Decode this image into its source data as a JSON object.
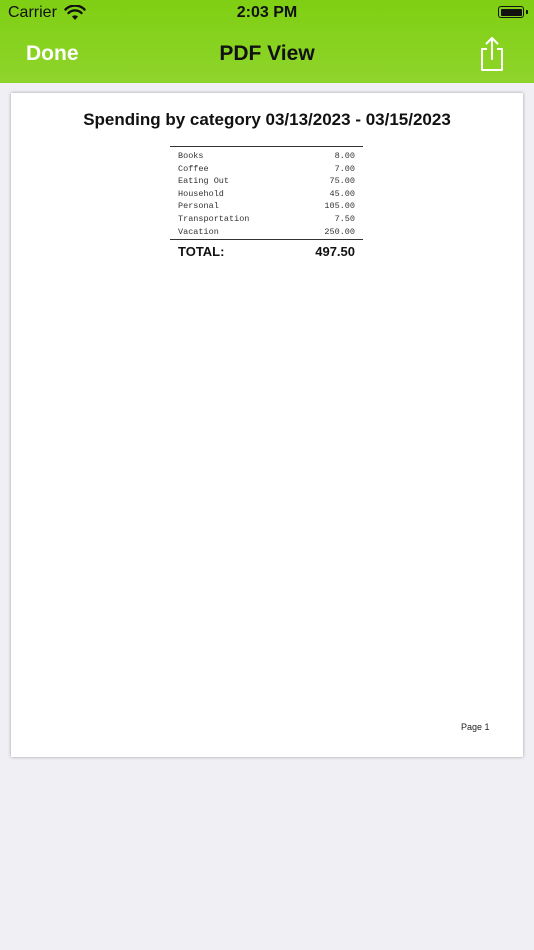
{
  "status_bar": {
    "carrier": "Carrier",
    "time": "2:03 PM"
  },
  "nav": {
    "done_label": "Done",
    "title": "PDF View",
    "share_icon": "share-icon"
  },
  "colors": {
    "nav_bar": "#8ccf22",
    "background": "#efeff4"
  },
  "report": {
    "title": "Spending by category 03/13/2023 - 03/15/2023",
    "rows": [
      {
        "category": "Books",
        "amount": "8.00"
      },
      {
        "category": "Coffee",
        "amount": "7.00"
      },
      {
        "category": "Eating Out",
        "amount": "75.00"
      },
      {
        "category": "Household",
        "amount": "45.00"
      },
      {
        "category": "Personal",
        "amount": "105.00"
      },
      {
        "category": "Transportation",
        "amount": "7.50"
      },
      {
        "category": "Vacation",
        "amount": "250.00"
      }
    ],
    "total_label": "TOTAL:",
    "total_value": "497.50",
    "page_label": "Page 1"
  }
}
